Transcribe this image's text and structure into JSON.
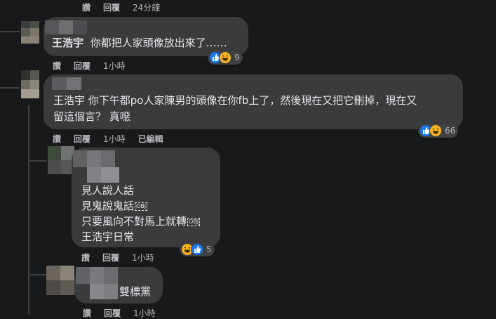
{
  "colors": {
    "background": "#18191a",
    "bubble": "#3a3b3c",
    "text_primary": "#e4e6eb",
    "text_secondary": "#b0b3b8",
    "like_blue": "#1877f2",
    "haha_yellow": "#f7b125"
  },
  "top_actions": {
    "like": "讚",
    "reply": "回覆",
    "time": "24分鐘"
  },
  "comments": [
    {
      "author": "王浩宇",
      "text": "你都把人家頭像放出來了……",
      "reaction_icons": [
        "like-icon",
        "haha-icon"
      ],
      "reaction_count": "9",
      "actions": {
        "like": "讚",
        "reply": "回覆",
        "time": "1小時"
      }
    },
    {
      "line1": "王浩宇  你下午都po人家陳男的頭像在你fb上了，然後現在又把它刪掉，現在又",
      "line2": "留這個言？ 真噁",
      "reaction_icons": [
        "like-icon",
        "haha-icon"
      ],
      "reaction_count": "66",
      "actions": {
        "like": "讚",
        "reply": "回覆",
        "time": "1小時",
        "edited": "已編輯"
      }
    },
    {
      "lines": [
        "見人說人話",
        "見鬼說鬼話",
        "只要風向不對馬上就轉",
        "王浩宇日常"
      ],
      "tag_label": "OBJ",
      "reaction_icons": [
        "haha-icon",
        "like-icon"
      ],
      "reaction_count": "5",
      "actions": {
        "like": "讚",
        "reply": "回覆",
        "time": "1小時"
      }
    },
    {
      "text": "雙標黨",
      "actions": {
        "like": "讚",
        "reply": "回覆",
        "time": "1小時"
      }
    }
  ]
}
